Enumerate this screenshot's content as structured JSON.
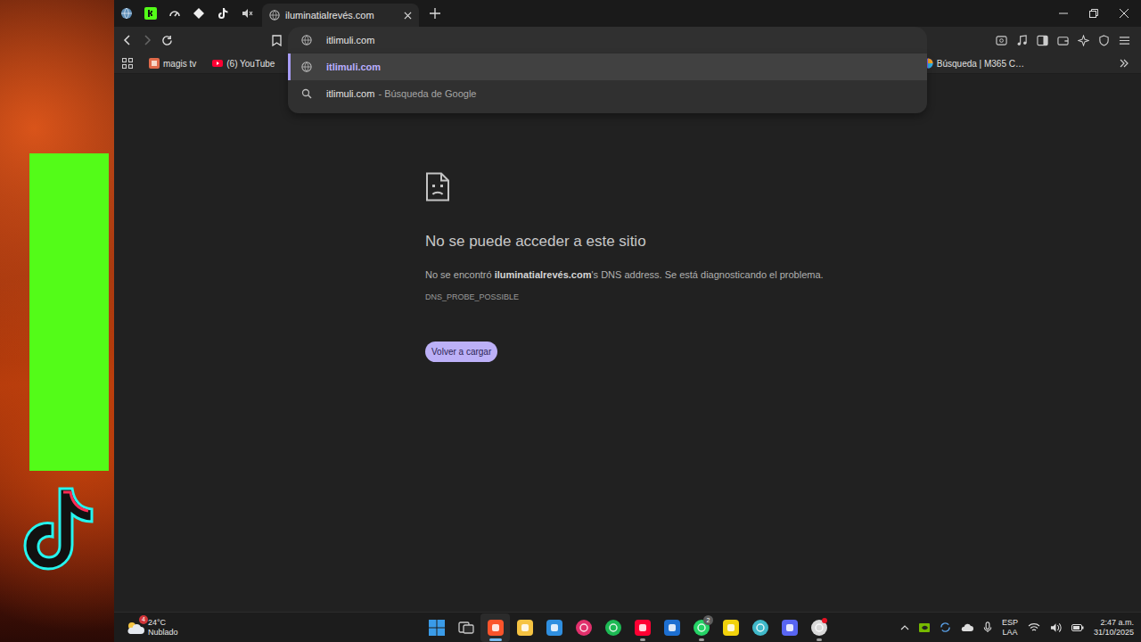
{
  "pinned_tabs": [
    {
      "kind": "globe"
    },
    {
      "kind": "kick"
    },
    {
      "kind": "gauge"
    },
    {
      "kind": "diamond"
    },
    {
      "kind": "tiktok"
    },
    {
      "kind": "muted"
    }
  ],
  "tabs": [
    {
      "label": "iluminatialrevés.com",
      "selected": true
    }
  ],
  "omnibox": {
    "value": "itlimuli.com",
    "focused": true
  },
  "suggestions": [
    {
      "kind": "url",
      "text": "itlimuli.com",
      "suffix": "",
      "selected": true
    },
    {
      "kind": "search",
      "text": "itlimuli.com",
      "suffix": "- Búsqueda de Google",
      "selected": false
    }
  ],
  "bookmarks": [
    {
      "kind": "magis",
      "label": "magis tv",
      "far": false
    },
    {
      "kind": "youtube",
      "label": "(6) YouTube",
      "far": false
    },
    {
      "kind": "gmail",
      "far": false
    },
    {
      "kind": "m365",
      "label": "Búsqueda | M365 C…",
      "far": true
    }
  ],
  "error": {
    "title": "No se puede acceder a este sitio",
    "message_before": "No se encontró ",
    "host": "iluminatialrevés.com",
    "message_after": "'s DNS address. Se está diagnosticando el problema.",
    "code": "DNS_PROBE_POSSIBLE",
    "button": "Volver a cargar"
  },
  "taskbar": {
    "weather": {
      "temperature": "24°C",
      "condition": "Nublado",
      "badge": "4"
    },
    "apps": [
      {
        "kind": "start",
        "color": "#3a9be8",
        "selected": false,
        "running": false,
        "dot": false
      },
      {
        "kind": "taskview",
        "color": "#c8c8c8",
        "selected": false,
        "running": false,
        "dot": false
      },
      {
        "kind": "brave",
        "color": "#fb542b",
        "selected": true,
        "running": true,
        "dot": false
      },
      {
        "kind": "explorer",
        "color": "#f5c342",
        "selected": false,
        "running": false,
        "dot": false
      },
      {
        "kind": "store",
        "color": "#2f8fe0",
        "selected": false,
        "running": false,
        "dot": false
      },
      {
        "kind": "instagram",
        "color": "#e1306c",
        "selected": false,
        "running": false,
        "dot": false
      },
      {
        "kind": "spotify",
        "color": "#1db954",
        "selected": false,
        "running": false,
        "dot": false
      },
      {
        "kind": "youtube",
        "color": "#ff0033",
        "selected": false,
        "running": true,
        "dot": false
      },
      {
        "kind": "outlook",
        "color": "#1d6fd1",
        "selected": false,
        "running": false,
        "dot": false
      },
      {
        "kind": "whatsapp",
        "color": "#25d366",
        "selected": false,
        "running": true,
        "dot": false,
        "badge": "2"
      },
      {
        "kind": "notes",
        "color": "#f2d20b",
        "selected": false,
        "running": false,
        "dot": false
      },
      {
        "kind": "copilot",
        "color": "#3fb8c9",
        "selected": false,
        "running": false,
        "dot": false
      },
      {
        "kind": "discord",
        "color": "#5865f2",
        "selected": false,
        "running": false,
        "dot": false
      },
      {
        "kind": "chatgpt",
        "color": "#d9d9d9",
        "selected": false,
        "running": true,
        "dot": true
      }
    ],
    "tray": {
      "language": "ESP",
      "layout": "LAA",
      "time": "2:47 a.m.",
      "date": "31/10/2025"
    }
  }
}
